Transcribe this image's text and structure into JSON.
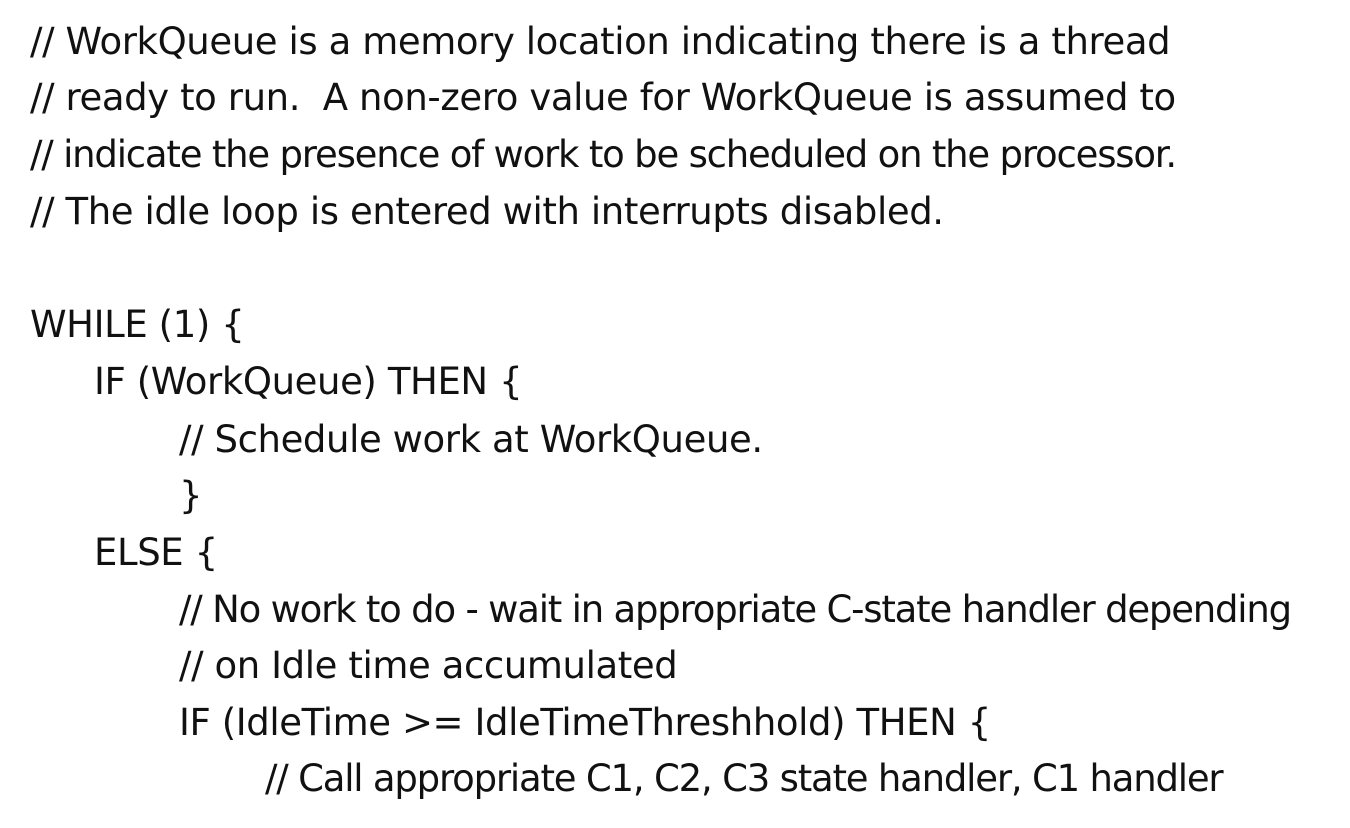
{
  "document": {
    "lines": [
      "// WorkQueue is a memory location indicating there is a thread",
      "// ready to run.  A non-zero value for WorkQueue is assumed to",
      "// indicate the presence of work to be scheduled on the processor.",
      "// The idle loop is entered with interrupts disabled.",
      "WHILE (1) {",
      "IF (WorkQueue) THEN {",
      "// Schedule work at WorkQueue.",
      "}",
      "ELSE {",
      "// No work to do - wait in appropriate C-state handler depending",
      "// on Idle time accumulated",
      "IF (IdleTime >= IdleTimeThreshhold) THEN {",
      "// Call appropriate C1, C2, C3 state handler, C1 handler"
    ]
  }
}
